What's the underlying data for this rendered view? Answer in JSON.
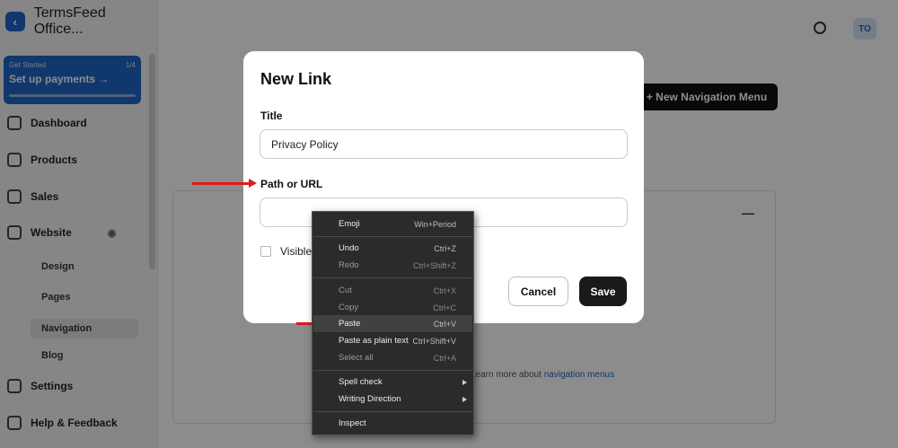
{
  "background": {
    "brand": {
      "name": "TermsFeed Office..."
    },
    "setup_card": {
      "label": "Get Started",
      "count": "1/4",
      "title": "Set up payments"
    },
    "nav": {
      "dashboard": "Dashboard",
      "products": "Products",
      "sales": "Sales",
      "website": "Website",
      "design": "Design",
      "pages": "Pages",
      "navigation": "Navigation",
      "blog": "Blog",
      "settings": "Settings",
      "help": "Help & Feedback"
    },
    "user_initials": "TO",
    "new_navigation_button": "+ New Navigation Menu",
    "learn_more_text": "Learn more about",
    "learn_more_link": "navigation menus"
  },
  "modal": {
    "title": "New Link",
    "title_field": {
      "label": "Title",
      "value": "Privacy Policy"
    },
    "path_field": {
      "label": "Path or URL",
      "value": ""
    },
    "visible_label": "Visible",
    "cancel_label": "Cancel",
    "save_label": "Save"
  },
  "context_menu": {
    "emoji": {
      "label": "Emoji",
      "shortcut": "Win+Period"
    },
    "undo": {
      "label": "Undo",
      "shortcut": "Ctrl+Z"
    },
    "redo": {
      "label": "Redo",
      "shortcut": "Ctrl+Shift+Z"
    },
    "cut": {
      "label": "Cut",
      "shortcut": "Ctrl+X"
    },
    "copy": {
      "label": "Copy",
      "shortcut": "Ctrl+C"
    },
    "paste": {
      "label": "Paste",
      "shortcut": "Ctrl+V"
    },
    "paste_plain": {
      "label": "Paste as plain text",
      "shortcut": "Ctrl+Shift+V"
    },
    "select_all": {
      "label": "Select all",
      "shortcut": "Ctrl+A"
    },
    "spell_check": {
      "label": "Spell check"
    },
    "writing_direction": {
      "label": "Writing Direction"
    },
    "inspect": {
      "label": "Inspect"
    }
  },
  "colors": {
    "annotation_arrow": "#e01a1a",
    "brand_blue": "#1e66c7",
    "save_button": "#1a1a1a"
  }
}
